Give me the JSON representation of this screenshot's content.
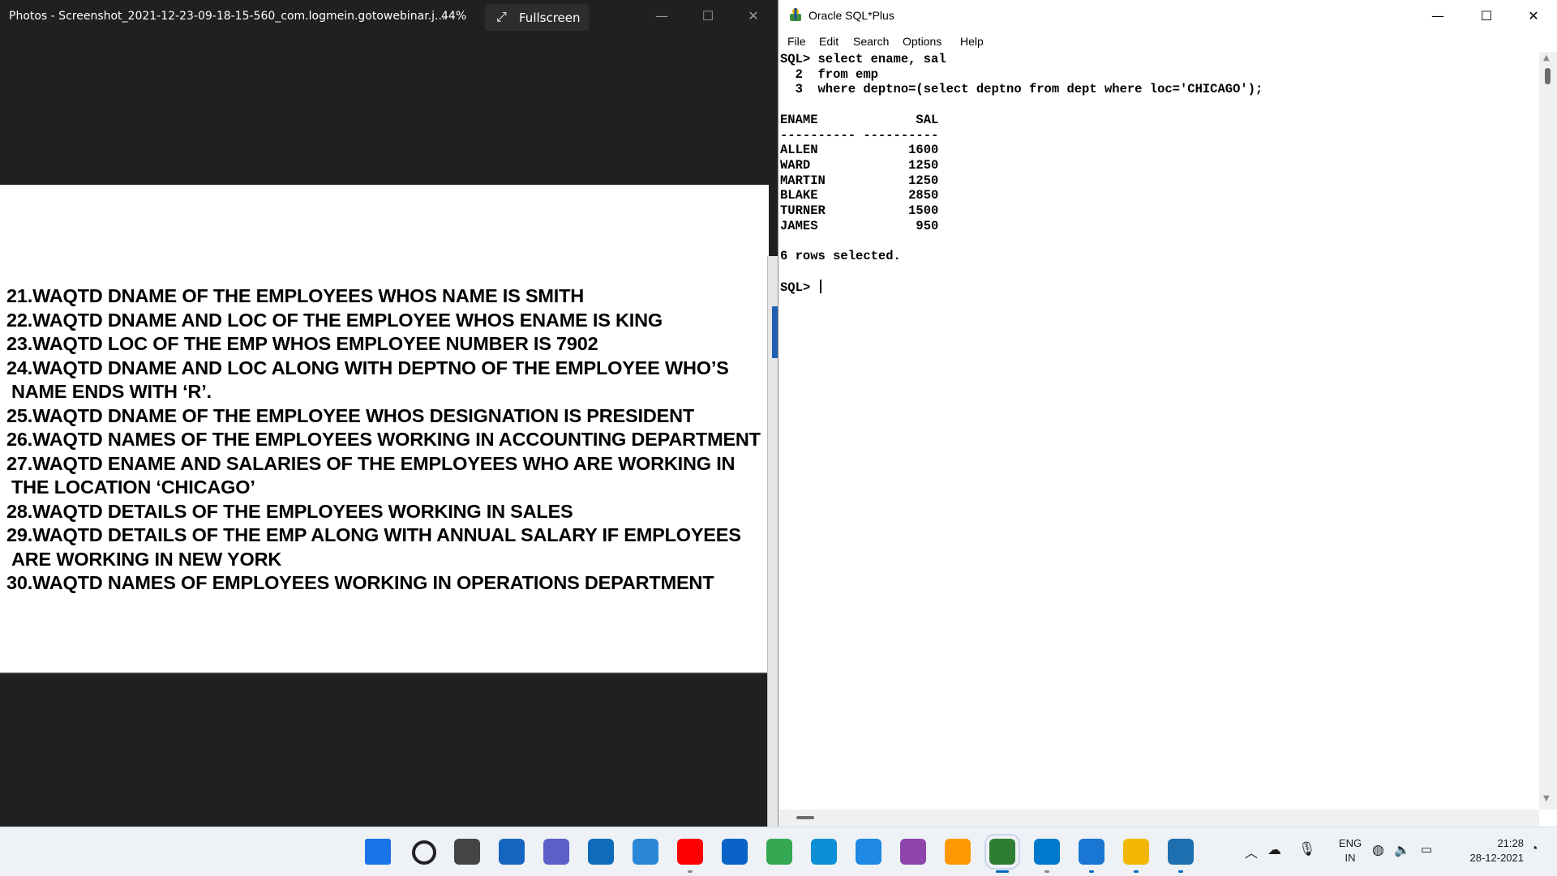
{
  "photos_window": {
    "title": "Photos - Screenshot_2021-12-23-09-18-15-560_com.logmein.gotowebinar.j...",
    "zoom": "44%",
    "fullscreen_label": "Fullscreen",
    "lines": [
      "21.WAQTD DNAME OF THE EMPLOYEES WHOS NAME IS SMITH",
      "22.WAQTD DNAME AND LOC OF THE EMPLOYEE WHOS ENAME IS KING",
      "23.WAQTD LOC OF THE EMP WHOS EMPLOYEE NUMBER IS 7902",
      "24.WAQTD DNAME AND LOC ALONG WITH DEPTNO OF THE EMPLOYEE WHO’S",
      "NAME ENDS WITH ‘R’.",
      "25.WAQTD DNAME OF THE EMPLOYEE WHOS DESIGNATION IS PRESIDENT",
      "26.WAQTD NAMES OF THE EMPLOYEES WORKING IN ACCOUNTING DEPARTMENT",
      "27.WAQTD ENAME AND SALARIES OF THE EMPLOYEES WHO ARE WORKING IN",
      "THE LOCATION ‘CHICAGO’",
      "28.WAQTD DETAILS OF THE EMPLOYEES WORKING IN SALES",
      "29.WAQTD DETAILS OF THE EMP ALONG WITH ANNUAL SALARY IF EMPLOYEES",
      "ARE WORKING IN NEW YORK",
      "30.WAQTD NAMES OF EMPLOYEES WORKING IN OPERATIONS DEPARTMENT"
    ]
  },
  "sqlplus_window": {
    "title": "Oracle SQL*Plus",
    "menu": [
      "File",
      "Edit",
      "Search",
      "Options",
      "Help"
    ],
    "console_text": "SQL> select ename, sal\n  2  from emp\n  3  where deptno=(select deptno from dept where loc='CHICAGO');\n\nENAME             SAL\n---------- ----------\nALLEN            1600\nWARD             1250\nMARTIN           1250\nBLAKE            2850\nTURNER           1500\nJAMES             950\n\n6 rows selected.\n\nSQL> "
  },
  "taskbar": {
    "apps": [
      {
        "name": "start",
        "color": "#1a73e8"
      },
      {
        "name": "search",
        "color": "#222222"
      },
      {
        "name": "task-view",
        "color": "#444444"
      },
      {
        "name": "widgets",
        "color": "#1565c0"
      },
      {
        "name": "teams-chat",
        "color": "#5b5fc7"
      },
      {
        "name": "store",
        "color": "#0f6cbd"
      },
      {
        "name": "phone",
        "color": "#2b88d8"
      },
      {
        "name": "youtube",
        "color": "#ff0000"
      },
      {
        "name": "mail",
        "color": "#0a64c8"
      },
      {
        "name": "chrome",
        "color": "#34a853"
      },
      {
        "name": "edge",
        "color": "#0c8fd6"
      },
      {
        "name": "remote-desktop",
        "color": "#1e88e5"
      },
      {
        "name": "git",
        "color": "#8e44ad"
      },
      {
        "name": "sublime-text",
        "color": "#ff9800"
      },
      {
        "name": "sqlplus",
        "color": "#2e7d32"
      },
      {
        "name": "vscode",
        "color": "#007acc"
      },
      {
        "name": "notepad",
        "color": "#1976d2"
      },
      {
        "name": "file-explorer",
        "color": "#f2b705"
      },
      {
        "name": "photos",
        "color": "#1e6fb0"
      }
    ],
    "lang_top": "ENG",
    "lang_bottom": "IN",
    "time": "21:28",
    "date": "28-12-2021"
  }
}
